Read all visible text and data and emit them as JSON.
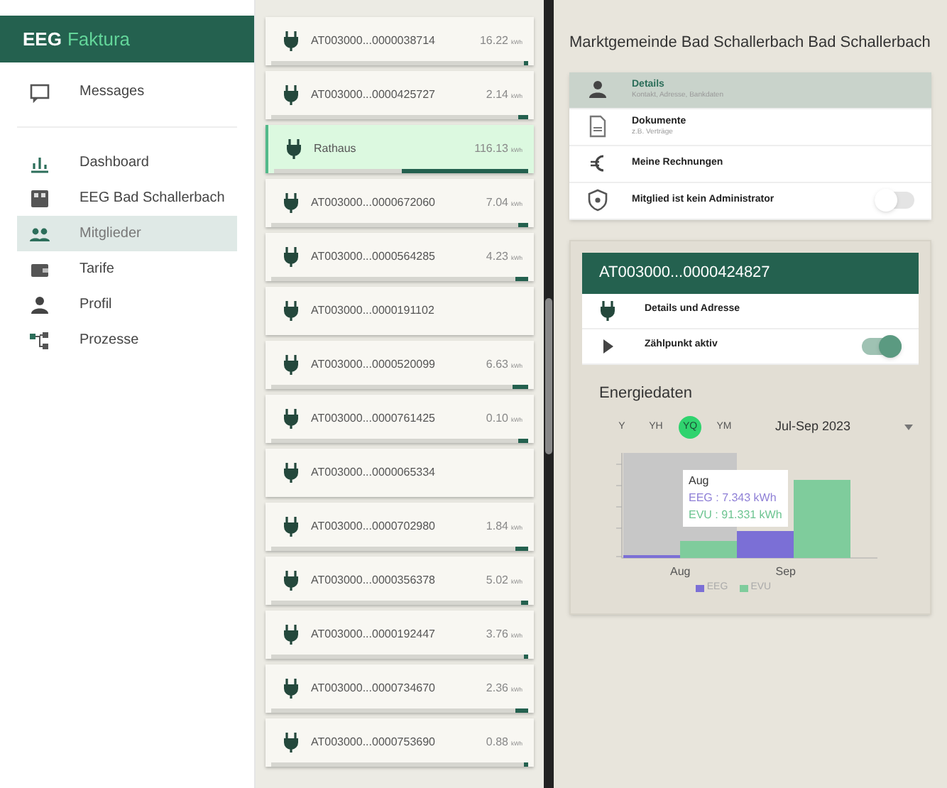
{
  "app": {
    "brand_main": "EEG",
    "brand_accent": "Faktura"
  },
  "sidebar": {
    "items": [
      {
        "label": "Messages",
        "selected": false
      },
      {
        "label": "Dashboard",
        "selected": false
      },
      {
        "label": "EEG Bad Schallerbach",
        "selected": false
      },
      {
        "label": "Mitglieder",
        "selected": true
      },
      {
        "label": "Tarife",
        "selected": false
      },
      {
        "label": "Profil",
        "selected": false
      },
      {
        "label": "Prozesse",
        "selected": false
      }
    ]
  },
  "meters": [
    {
      "name": "AT003000...0000038714",
      "value": "16.22",
      "unit": "kWh",
      "level": 0.01,
      "selected": false
    },
    {
      "name": "AT003000...0000425727",
      "value": "2.14",
      "unit": "kWh",
      "level": 0.04,
      "selected": false
    },
    {
      "name": "Rathaus",
      "value": "116.13",
      "unit": "kWh",
      "level": 0.5,
      "selected": true
    },
    {
      "name": "AT003000...0000672060",
      "value": "7.04",
      "unit": "kWh",
      "level": 0.04,
      "selected": false
    },
    {
      "name": "AT003000...0000564285",
      "value": "4.23",
      "unit": "kWh",
      "level": 0.05,
      "selected": false
    },
    {
      "name": "AT003000...0000191102",
      "selected": false
    },
    {
      "name": "AT003000...0000520099",
      "value": "6.63",
      "unit": "kWh",
      "level": 0.06,
      "selected": false
    },
    {
      "name": "AT003000...0000761425",
      "value": "0.10",
      "unit": "kWh",
      "level": 0.04,
      "selected": false
    },
    {
      "name": "AT003000...0000065334",
      "selected": false
    },
    {
      "name": "AT003000...0000702980",
      "value": "1.84",
      "unit": "kWh",
      "level": 0.05,
      "selected": false
    },
    {
      "name": "AT003000...0000356378",
      "value": "5.02",
      "unit": "kWh",
      "level": 0.03,
      "selected": false
    },
    {
      "name": "AT003000...0000192447",
      "value": "3.76",
      "unit": "kWh",
      "level": 0.01,
      "selected": false
    },
    {
      "name": "AT003000...0000734670",
      "value": "2.36",
      "unit": "kWh",
      "level": 0.05,
      "selected": false
    },
    {
      "name": "AT003000...0000753690",
      "value": "0.88",
      "unit": "kWh",
      "level": 0.01,
      "selected": false
    }
  ],
  "member": {
    "title": "Marktgemeinde Bad Schallerbach Bad Schallerbach",
    "menu": [
      {
        "kind": "link",
        "label": "Details",
        "subtitle": "Kontakt, Adresse, Bankdaten",
        "selected": true
      },
      {
        "kind": "link",
        "label": "Dokumente",
        "subtitle": "z.B. Verträge",
        "selected": false
      },
      {
        "kind": "link",
        "label": "Meine Rechnungen",
        "selected": false
      },
      {
        "kind": "toggle",
        "label": "Mitglied ist kein Administrator",
        "on": false
      }
    ]
  },
  "meter_detail": {
    "title": "AT003000...0000424827",
    "rows": [
      {
        "kind": "link",
        "label": "Details und Adresse"
      },
      {
        "kind": "toggle",
        "label": "Zählpunkt aktiv",
        "on": true
      }
    ]
  },
  "energy": {
    "title": "Energiedaten",
    "periods": [
      {
        "label": "Y",
        "selected": false
      },
      {
        "label": "YH",
        "selected": false
      },
      {
        "label": "YQ",
        "selected": true
      },
      {
        "label": "YM",
        "selected": false
      }
    ],
    "range": "Jul-Sep 2023",
    "x_labels": [
      "Aug",
      "Sep"
    ],
    "tooltip": {
      "title": "Aug",
      "lines": [
        {
          "text": "EEG : 7.343 kWh",
          "color": "#8e7fd6"
        },
        {
          "text": "EVU : 91.331 kWh",
          "color": "#6cc490"
        }
      ]
    },
    "legend": [
      {
        "label": "EEG",
        "color": "#7b6fd6"
      },
      {
        "label": "EVU",
        "color": "#7fcc9c"
      }
    ]
  }
}
